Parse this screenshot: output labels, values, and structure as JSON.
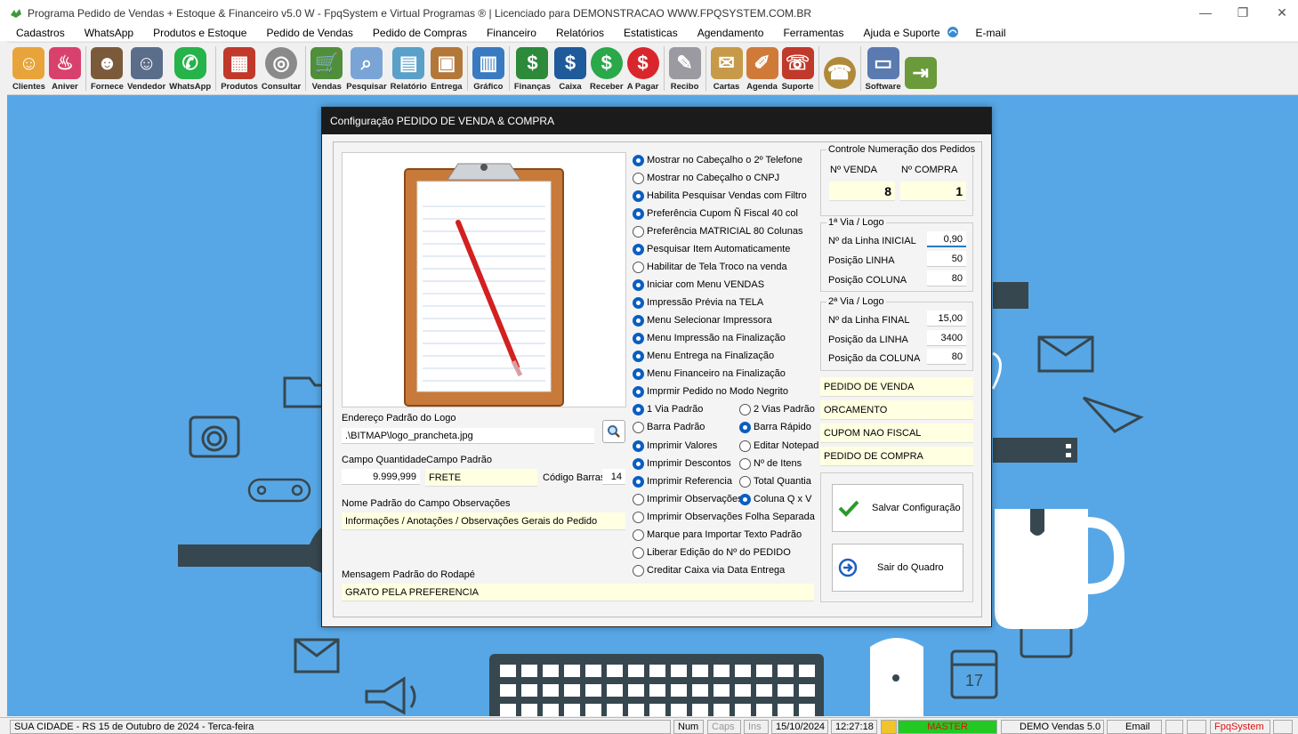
{
  "window": {
    "title": "Programa Pedido de Vendas + Estoque & Financeiro v5.0 W - FpqSystem e Virtual Programas ® | Licenciado para  DEMONSTRACAO WWW.FPQSYSTEM.COM.BR",
    "minimize": "—",
    "restore": "❐",
    "close": "✕"
  },
  "menu": [
    {
      "label": "Cadastros"
    },
    {
      "label": "WhatsApp"
    },
    {
      "label": "Produtos e Estoque"
    },
    {
      "label": "Pedido de Vendas"
    },
    {
      "label": "Pedido de Compras"
    },
    {
      "label": "Financeiro"
    },
    {
      "label": "Relatórios"
    },
    {
      "label": "Estatisticas"
    },
    {
      "label": "Agendamento"
    },
    {
      "label": "Ferramentas"
    },
    {
      "label": "Ajuda e Suporte"
    },
    {
      "label": "E-mail"
    }
  ],
  "toolbar": [
    {
      "label": "Clientes",
      "icon": "clients-icon",
      "color": "#e8a43a"
    },
    {
      "label": "Aniver",
      "icon": "cake-icon",
      "color": "#d9416d"
    },
    {
      "label": "Fornece",
      "icon": "supplier-icon",
      "color": "#7a5a3a"
    },
    {
      "label": "Vendedor",
      "icon": "seller-icon",
      "color": "#5a6d8a"
    },
    {
      "label": "WhatsApp",
      "icon": "whatsapp-icon",
      "color": "#25b34a"
    },
    {
      "label": "Produtos",
      "icon": "products-icon",
      "color": "#c0392b"
    },
    {
      "label": "Consultar",
      "icon": "consult-icon",
      "color": "#8a8a8a"
    },
    {
      "label": "Vendas",
      "icon": "cart-icon",
      "color": "#4f8f3a"
    },
    {
      "label": "Pesquisar",
      "icon": "search-docs-icon",
      "color": "#7aa4d6"
    },
    {
      "label": "Relatório",
      "icon": "report-icon",
      "color": "#5aa0c8"
    },
    {
      "label": "Entrega",
      "icon": "delivery-icon",
      "color": "#b3773a"
    },
    {
      "label": "Gráfico",
      "icon": "chart-icon",
      "color": "#3a7ac0"
    },
    {
      "label": "Finanças",
      "icon": "finance-icon",
      "color": "#2c8a3a"
    },
    {
      "label": "Caixa",
      "icon": "cash-icon",
      "color": "#1f5a9a"
    },
    {
      "label": "Receber",
      "icon": "receive-icon",
      "color": "#2aa84a"
    },
    {
      "label": "A Pagar",
      "icon": "pay-icon",
      "color": "#d8262c"
    },
    {
      "label": "Recibo",
      "icon": "receipt-icon",
      "color": "#9a9aa0"
    },
    {
      "label": "Cartas",
      "icon": "letters-icon",
      "color": "#c79a4a"
    },
    {
      "label": "Agenda",
      "icon": "agenda-icon",
      "color": "#d07a3a"
    },
    {
      "label": "Suporte",
      "icon": "support-icon",
      "color": "#c0392b"
    },
    {
      "label": "",
      "icon": "phone-icon",
      "color": "#b08a3a"
    },
    {
      "label": "Software",
      "icon": "software-icon",
      "color": "#5a7ab0"
    },
    {
      "label": "",
      "icon": "exit-icon",
      "color": "#6a9a3a"
    }
  ],
  "dialog": {
    "title": "Configuração PEDIDO DE VENDA & COMPRA",
    "logo_label": "Endereço Padrão do Logo",
    "logo_path": ".\\BITMAP\\logo_prancheta.jpg",
    "qty_label": "Campo Quantidade",
    "default_label": "Campo Padrão",
    "qty_value": "9.999,999",
    "default_value": "FRETE",
    "barcode_label": "Código Barras:",
    "barcode_value": "14",
    "obs_label": "Nome Padrão do Campo Observações",
    "obs_value": "Informações / Anotações / Observações Gerais do Pedido",
    "footer_label": "Mensagem Padrão do Rodapé",
    "footer_value": "GRATO PELA PREFERENCIA",
    "options": [
      {
        "label": "Mostrar no Cabeçalho o 2º Telefone",
        "on": true
      },
      {
        "label": "Mostrar no Cabeçalho o CNPJ",
        "on": false
      },
      {
        "label": "Habilita Pesquisar Vendas com Filtro",
        "on": true
      },
      {
        "label": "Preferência Cupom Ñ Fiscal 40 col",
        "on": true
      },
      {
        "label": "Preferência MATRICIAL 80 Colunas",
        "on": false
      },
      {
        "label": "Pesquisar Item Automaticamente",
        "on": true
      },
      {
        "label": "Habilitar de Tela Troco na venda",
        "on": false
      },
      {
        "label": "Iniciar com Menu VENDAS",
        "on": true
      },
      {
        "label": "Impressão Prévia na TELA",
        "on": true
      },
      {
        "label": "Menu Selecionar Impressora",
        "on": true
      },
      {
        "label": "Menu Impressão na Finalização",
        "on": true
      },
      {
        "label": "Menu Entrega na Finalização",
        "on": true
      },
      {
        "label": "Menu Financeiro na Finalização",
        "on": true
      },
      {
        "label": "Imprmir Pedido no Modo Negrito",
        "on": true
      }
    ],
    "pairs": [
      [
        {
          "label": "1 Via Padrão",
          "on": true
        },
        {
          "label": "2 Vias Padrão",
          "on": false
        }
      ],
      [
        {
          "label": "Barra Padrão",
          "on": false
        },
        {
          "label": "Barra Rápido",
          "on": true
        }
      ],
      [
        {
          "label": "Imprimir Valores",
          "on": true
        },
        {
          "label": "Editar Notepad",
          "on": false
        }
      ],
      [
        {
          "label": "Imprimir Descontos",
          "on": true
        },
        {
          "label": "Nº de Itens",
          "on": false
        }
      ],
      [
        {
          "label": "Imprimir Referencia",
          "on": true
        },
        {
          "label": "Total Quantia",
          "on": false
        }
      ],
      [
        {
          "label": "Imprimir Observações",
          "on": false
        },
        {
          "label": "Coluna Q x V",
          "on": true
        }
      ]
    ],
    "tail_options": [
      {
        "label": "Imprimir Observações Folha Separada",
        "on": false
      },
      {
        "label": "Marque para Importar Texto Padrão",
        "on": false
      },
      {
        "label": "Liberar Edição do Nº do PEDIDO",
        "on": false
      },
      {
        "label": "Creditar Caixa via Data Entrega",
        "on": false
      }
    ],
    "numbering": {
      "title": "Controle Numeração dos Pedidos",
      "sale_label": "Nº VENDA",
      "purchase_label": "Nº COMPRA",
      "sale_value": "8",
      "purchase_value": "1"
    },
    "via1": {
      "title": "1ª Via / Logo",
      "line_label": "Nº da Linha INICIAL",
      "line_value": "0,90",
      "pos_line_label": "Posição LINHA",
      "pos_line_value": "50",
      "pos_col_label": "Posição COLUNA",
      "pos_col_value": "80"
    },
    "via2": {
      "title": "2ª Via / Logo",
      "line_label": "Nº da Linha FINAL",
      "line_value": "15,00",
      "pos_line_label": "Posição da LINHA",
      "pos_line_value": "3400",
      "pos_col_label": "Posição da COLUNA",
      "pos_col_value": "80"
    },
    "doc_titles": [
      "PEDIDO DE VENDA",
      "ORCAMENTO",
      "CUPOM NAO FISCAL",
      "PEDIDO DE COMPRA"
    ],
    "save_label": "Salvar Configuração",
    "exit_label": "Sair do Quadro"
  },
  "status": {
    "city": "SUA CIDADE - RS 15 de Outubro de 2024 - Terca-feira",
    "num": "Num",
    "caps": "Caps",
    "ins": "Ins",
    "date": "15/10/2024",
    "time": "12:27:18",
    "user": "MASTER",
    "version": "DEMO Vendas 5.0",
    "email": "Email",
    "brand": "FpqSystem"
  }
}
